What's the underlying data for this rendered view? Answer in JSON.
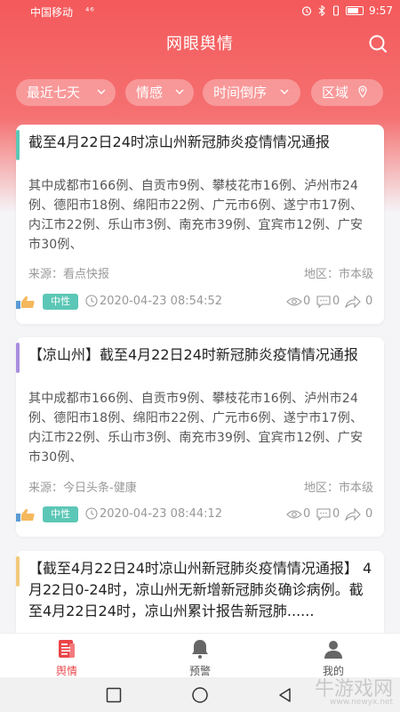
{
  "status_bar": {
    "carrier": "中国移动",
    "signal": "⁴⁶",
    "time": "9:57"
  },
  "header": {
    "title": "网眼舆情"
  },
  "filters": [
    {
      "label": "最近七天"
    },
    {
      "label": "情感"
    },
    {
      "label": "时间倒序"
    },
    {
      "label": "区域"
    }
  ],
  "cards": [
    {
      "accent": "#5cc7b6",
      "title": "截至4月22日24时凉山州新冠肺炎疫情情况通报",
      "body": "其中成都市166例、自贡市9例、攀枝花市16例、泸州市24例、德阳市18例、绵阳市22例、广元市6例、遂宁市17例、内江市22例、乐山市3例、南充市39例、宜宾市12例、广安市30例、",
      "source": "来源：看点快报",
      "region": "地区：市本级",
      "sentiment": "中性",
      "time": "2020-04-23 08:54:52",
      "views": "0",
      "comments": "0",
      "shares": "0"
    },
    {
      "accent": "#a98de0",
      "title": "【凉山州】截至4月22日24时新冠肺炎疫情情况通报",
      "body": "其中成都市166例、自贡市9例、攀枝花市16例、泸州市24例、德阳市18例、绵阳市22例、广元市6例、遂宁市17例、内江市22例、乐山市3例、南充市39例、宜宾市12例、广安市30例、",
      "source": "来源：今日头条-健康",
      "region": "地区：市本级",
      "sentiment": "中性",
      "time": "2020-04-23 08:44:12",
      "views": "0",
      "comments": "0",
      "shares": "0"
    },
    {
      "accent": "#f2c97a",
      "title": "【截至4月22日24时凉山州新冠肺炎疫情情况通报】 4月22日0-24时，凉山州无新增新冠肺炎确诊病例。截至4月22日24时，凉山州累计报告新冠肺......"
    }
  ],
  "tabs": [
    {
      "label": "舆情",
      "icon": "news-icon",
      "active": true
    },
    {
      "label": "预警",
      "icon": "bell-icon",
      "active": false
    },
    {
      "label": "我的",
      "icon": "user-icon",
      "active": false
    }
  ],
  "watermark": {
    "text": "牛游戏网",
    "url": "www.newyx.net"
  },
  "colors": {
    "brand": "#f4595b",
    "active_tab": "#e94549",
    "neutral_tag": "#5cc7b6"
  }
}
